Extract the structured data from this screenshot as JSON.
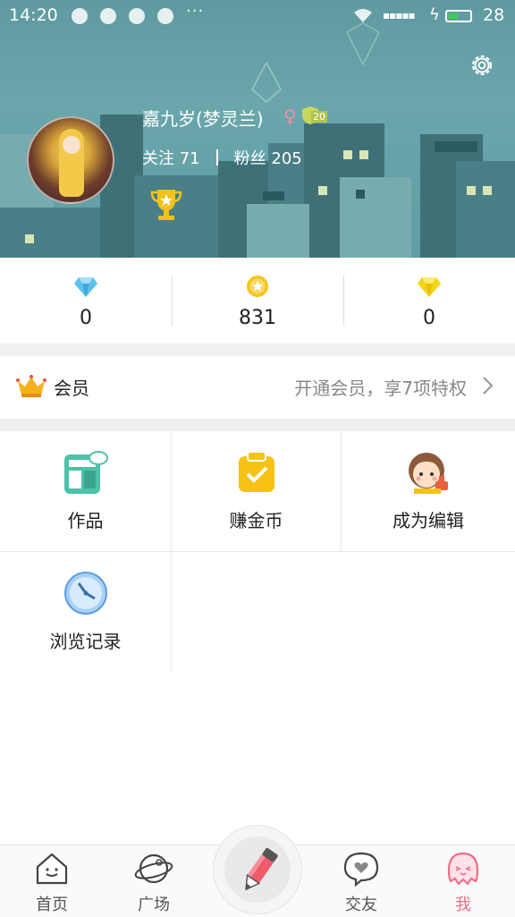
{
  "status_bar": {
    "time": "14:20",
    "overflow": "···",
    "battery": "28"
  },
  "profile": {
    "name": "嘉九岁(梦灵兰)",
    "gender_symbol": "♀",
    "level": "20",
    "following_label": "关注",
    "following_count": "71",
    "followers_label": "粉丝",
    "followers_count": "205"
  },
  "stats": [
    {
      "icon": "blue-diamond-icon",
      "value": "0",
      "color": "#4fb8ef"
    },
    {
      "icon": "gold-coin-icon",
      "value": "831",
      "color": "#f5c518"
    },
    {
      "icon": "yellow-diamond-icon",
      "value": "0",
      "color": "#f7d417"
    }
  ],
  "vip": {
    "label": "会员",
    "promo": "开通会员，享7项特权"
  },
  "grid": [
    {
      "icon": "works-icon",
      "label": "作品"
    },
    {
      "icon": "earn-coins-icon",
      "label": "赚金币"
    },
    {
      "icon": "become-editor-icon",
      "label": "成为编辑"
    },
    {
      "icon": "history-clock-icon",
      "label": "浏览记录"
    }
  ],
  "nav": {
    "home": "首页",
    "square": "广场",
    "friends": "交友",
    "me": "我"
  },
  "colors": {
    "accent_pink": "#ef6f86",
    "header_teal": "#5e9aa0"
  }
}
